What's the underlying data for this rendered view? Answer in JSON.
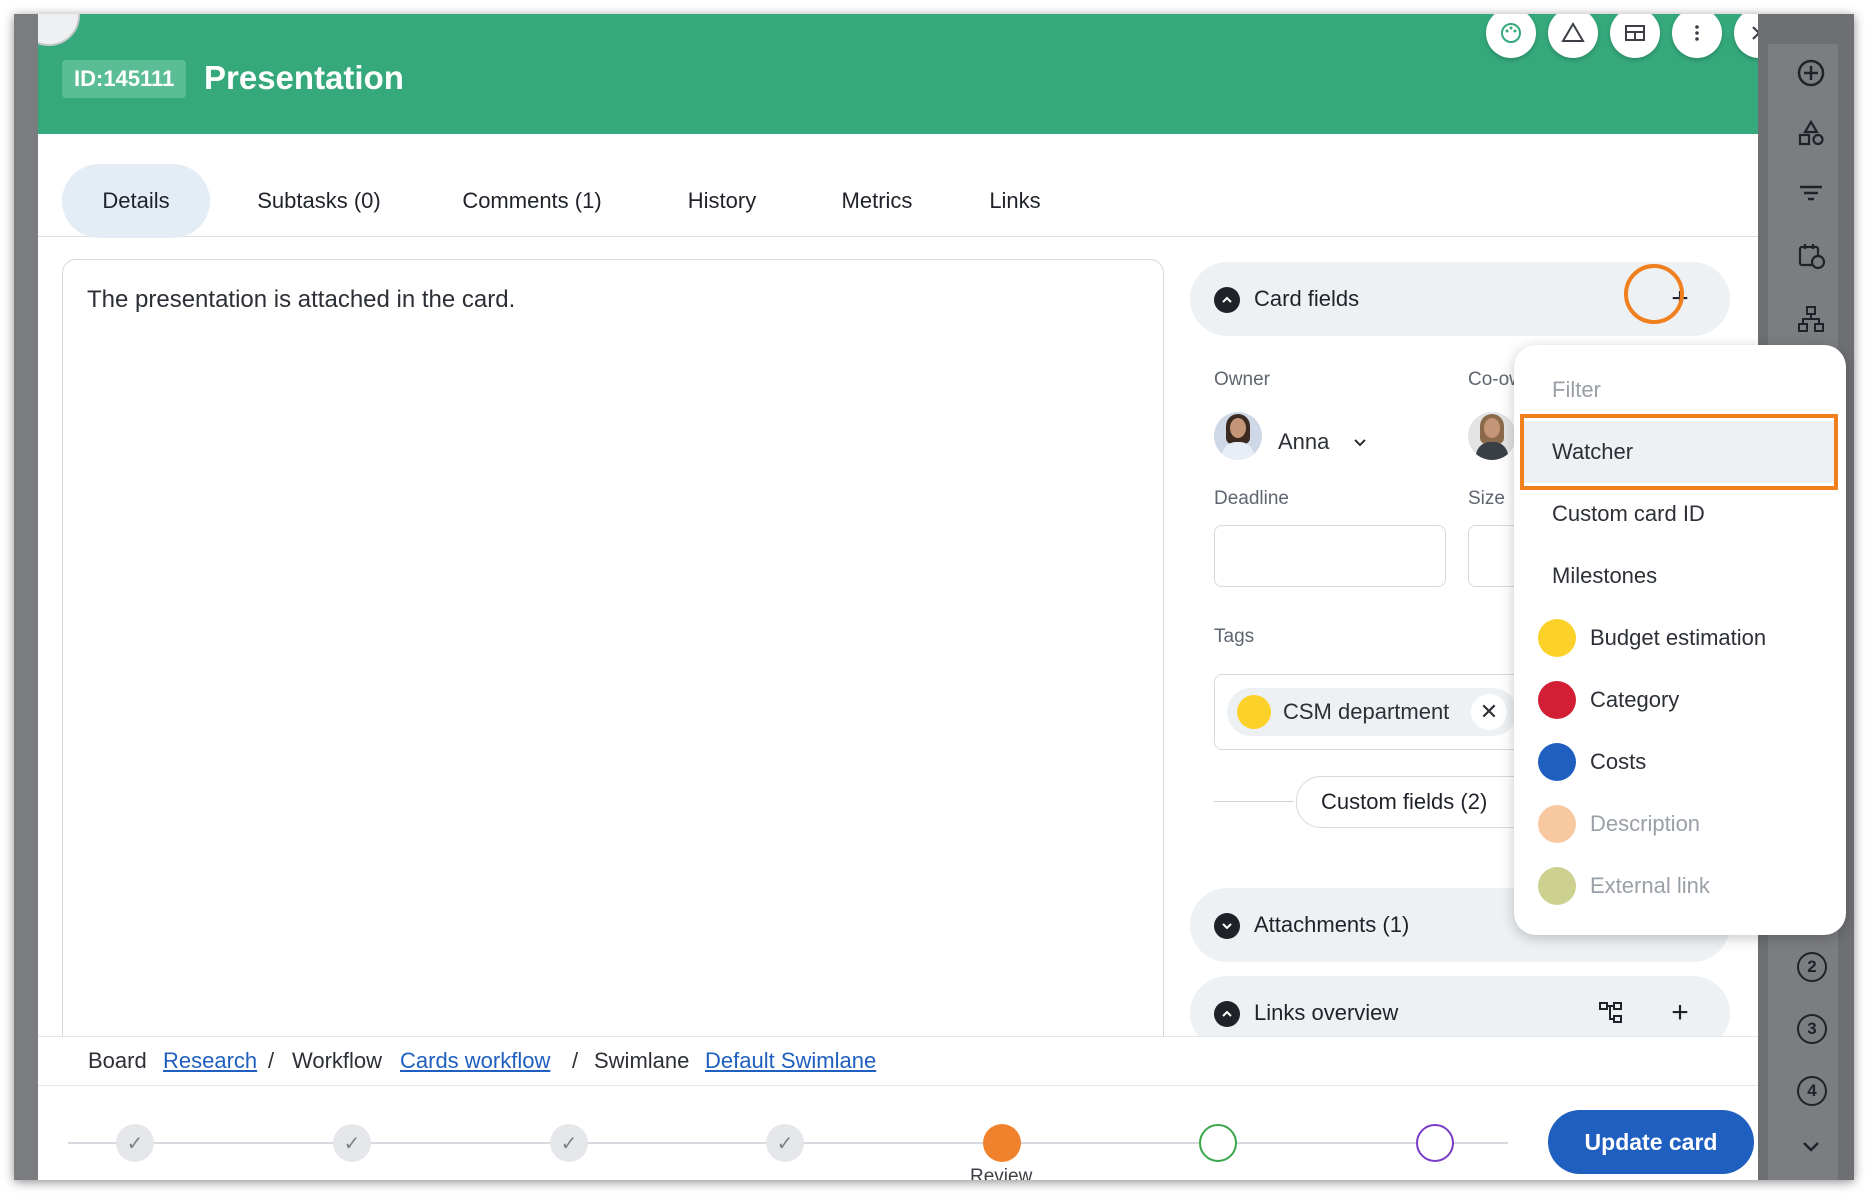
{
  "header": {
    "card_id": "ID:145111",
    "title": "Presentation",
    "icons": [
      "palette-icon",
      "warning-icon",
      "layout-icon",
      "more-icon",
      "close-icon"
    ]
  },
  "tabs": [
    {
      "label": "Details",
      "active": true
    },
    {
      "label": "Subtasks (0)"
    },
    {
      "label": "Comments (1)"
    },
    {
      "label": "History"
    },
    {
      "label": "Metrics"
    },
    {
      "label": "Links"
    }
  ],
  "description": "The presentation is attached in the card.",
  "card_fields": {
    "title": "Card fields",
    "owner_label": "Owner",
    "owner_name": "Anna",
    "coowner_label": "Co-ow",
    "deadline_label": "Deadline",
    "size_label": "Size",
    "tags_label": "Tags",
    "tag": {
      "label": "CSM department",
      "color": "#fcd12a"
    },
    "custom_fields_label": "Custom fields (2)"
  },
  "attachments": {
    "title": "Attachments (1)"
  },
  "links_overview": {
    "title": "Links overview"
  },
  "dropdown": {
    "items": [
      {
        "label": "Filter",
        "muted": true
      },
      {
        "label": "Watcher",
        "highlighted": true
      },
      {
        "label": "Custom card ID"
      },
      {
        "label": "Milestones"
      },
      {
        "label": "Budget estimation",
        "color": "#fcd12a"
      },
      {
        "label": "Category",
        "color": "#d21f36"
      },
      {
        "label": "Costs",
        "color": "#1f5fc0"
      },
      {
        "label": "Description",
        "color": "#f8c8a0",
        "faded": true
      },
      {
        "label": "External link",
        "color": "#cdd190",
        "faded": true
      }
    ]
  },
  "breadcrumb": {
    "board_label": "Board",
    "board": "Research",
    "sep1": "/",
    "workflow_label": "Workflow",
    "workflow": "Cards workflow",
    "sep2": "/",
    "swimlane_label": "Swimlane",
    "swimlane": "Default Swimlane"
  },
  "progress": {
    "current_step_label": "Review",
    "done_steps": 4,
    "update_button": "Update card"
  },
  "colors": {
    "header": "#35a97c",
    "accent_blue": "#1f5fc0",
    "highlight_orange": "#f07f1d"
  }
}
